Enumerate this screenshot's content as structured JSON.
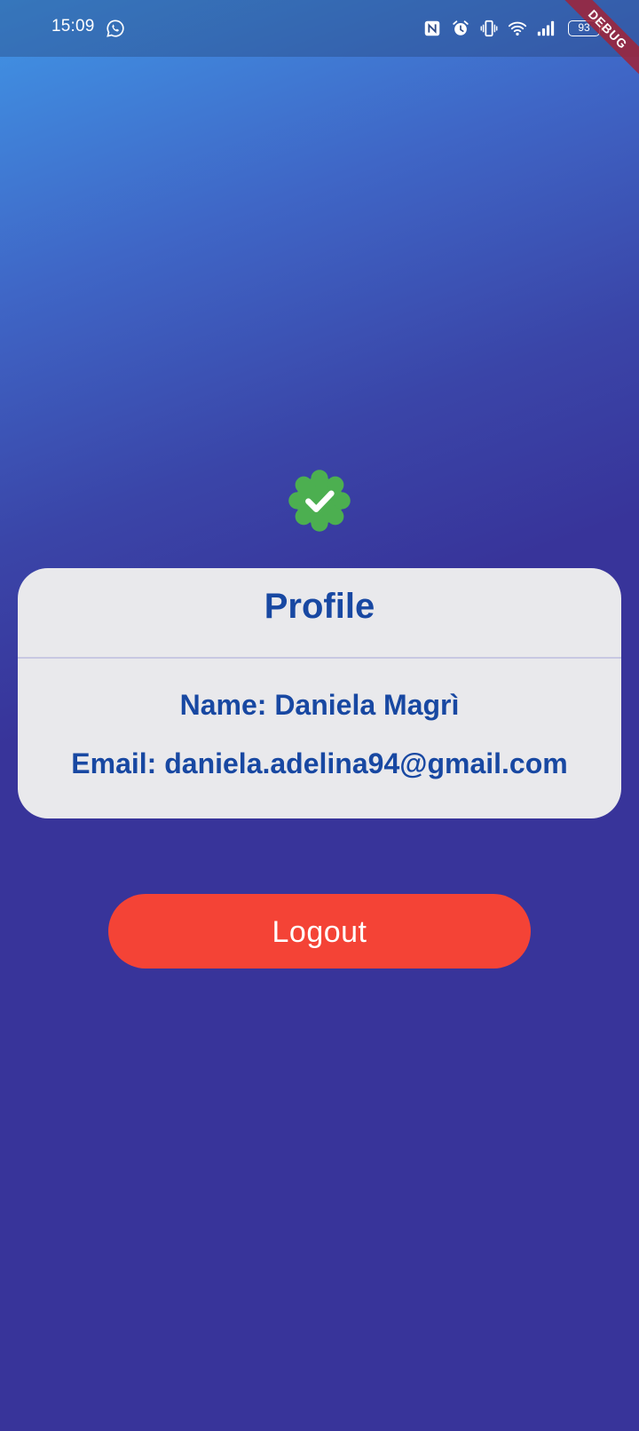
{
  "status_bar": {
    "time": "15:09",
    "battery_level": "93",
    "icons": [
      "whatsapp-icon",
      "nfc-icon",
      "alarm-icon",
      "vibrate-icon",
      "wifi-icon",
      "signal-icon",
      "battery-icon"
    ]
  },
  "debug_banner": {
    "label": "DEBUG"
  },
  "badge": {
    "icon": "verified-check-icon",
    "color": "#4caf50"
  },
  "profile": {
    "title": "Profile",
    "name_line": "Name: Daniela Magrì",
    "email_line": "Email: daniela.adelina94@gmail.com"
  },
  "actions": {
    "logout_label": "Logout"
  },
  "colors": {
    "accent_text": "#1848a2",
    "logout_button": "#f44336",
    "card_background": "#e9e9ec",
    "background_top": "#4196e6",
    "background_bottom": "#38349a"
  }
}
